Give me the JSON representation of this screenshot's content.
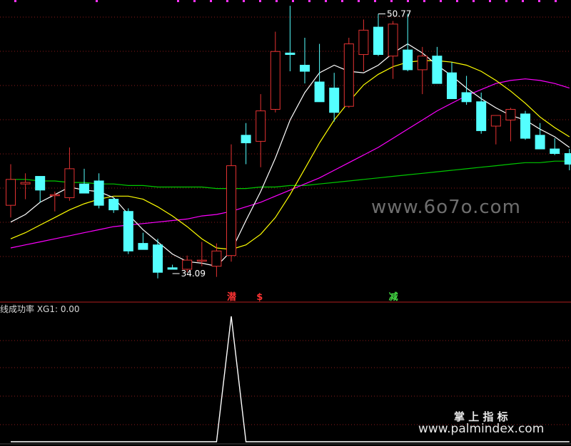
{
  "chart_data": {
    "type": "candlestick",
    "colors": {
      "up": "#e33232",
      "down": "#54ffff",
      "ma5": "#ffffff",
      "ma10": "#ffff00",
      "ma20": "#ff00ff",
      "ma60": "#00c800",
      "indicator": "#ffffff",
      "grid": "#8b1a1a",
      "mark_high": "#ffffff",
      "mark_low": "#ffffff"
    },
    "candles": [
      {
        "o": 38.2,
        "h": 40.9,
        "l": 37.4,
        "c": 39.9
      },
      {
        "o": 39.6,
        "h": 40.3,
        "l": 38.6,
        "c": 39.7
      },
      {
        "o": 40.1,
        "h": 40.1,
        "l": 38.4,
        "c": 39.2
      },
      {
        "o": 38.9,
        "h": 39.1,
        "l": 37.8,
        "c": 38.9
      },
      {
        "o": 38.7,
        "h": 42.0,
        "l": 38.5,
        "c": 40.6
      },
      {
        "o": 39.6,
        "h": 40.6,
        "l": 39.2,
        "c": 39.0
      },
      {
        "o": 39.8,
        "h": 40.3,
        "l": 38.0,
        "c": 38.2
      },
      {
        "o": 38.6,
        "h": 38.7,
        "l": 37.7,
        "c": 37.9
      },
      {
        "o": 37.8,
        "h": 38.0,
        "l": 35.0,
        "c": 35.2
      },
      {
        "o": 35.7,
        "h": 36.4,
        "l": 35.5,
        "c": 35.3
      },
      {
        "o": 35.6,
        "h": 36.0,
        "l": 33.4,
        "c": 33.8
      },
      {
        "o": 34.1,
        "h": 34.3,
        "l": 34.09,
        "c": 34.0
      },
      {
        "o": 34.0,
        "h": 34.9,
        "l": 33.8,
        "c": 34.6
      },
      {
        "o": 34.6,
        "h": 35.8,
        "l": 34.2,
        "c": 34.6
      },
      {
        "o": 34.2,
        "h": 35.7,
        "l": 33.5,
        "c": 35.2
      },
      {
        "o": 34.9,
        "h": 42.2,
        "l": 34.5,
        "c": 40.8
      },
      {
        "o": 42.8,
        "h": 43.6,
        "l": 40.9,
        "c": 42.3
      },
      {
        "o": 42.4,
        "h": 45.5,
        "l": 40.7,
        "c": 44.4
      },
      {
        "o": 44.5,
        "h": 49.6,
        "l": 44.3,
        "c": 48.3
      },
      {
        "o": 48.2,
        "h": 51.3,
        "l": 47.0,
        "c": 48.1
      },
      {
        "o": 47.4,
        "h": 49.2,
        "l": 46.2,
        "c": 47.0
      },
      {
        "o": 46.3,
        "h": 48.8,
        "l": 45.3,
        "c": 45.0
      },
      {
        "o": 45.9,
        "h": 46.9,
        "l": 43.7,
        "c": 44.3
      },
      {
        "o": 44.7,
        "h": 49.2,
        "l": 44.6,
        "c": 48.8
      },
      {
        "o": 48.1,
        "h": 50.4,
        "l": 47.0,
        "c": 49.7
      },
      {
        "o": 49.9,
        "h": 50.77,
        "l": 48.0,
        "c": 48.1
      },
      {
        "o": 48.0,
        "h": 50.3,
        "l": 46.5,
        "c": 50.1
      },
      {
        "o": 48.4,
        "h": 50.77,
        "l": 47.0,
        "c": 47.1
      },
      {
        "o": 47.1,
        "h": 48.6,
        "l": 45.5,
        "c": 48.0
      },
      {
        "o": 48.0,
        "h": 48.6,
        "l": 46.4,
        "c": 46.2
      },
      {
        "o": 46.9,
        "h": 47.6,
        "l": 45.2,
        "c": 45.2
      },
      {
        "o": 45.6,
        "h": 46.7,
        "l": 44.8,
        "c": 45.0
      },
      {
        "o": 45.0,
        "h": 45.6,
        "l": 42.9,
        "c": 43.1
      },
      {
        "o": 43.4,
        "h": 44.1,
        "l": 42.2,
        "c": 44.1
      },
      {
        "o": 43.8,
        "h": 44.6,
        "l": 42.4,
        "c": 44.5
      },
      {
        "o": 44.2,
        "h": 44.4,
        "l": 42.5,
        "c": 42.6
      },
      {
        "o": 42.8,
        "h": 43.6,
        "l": 42.0,
        "c": 41.9
      },
      {
        "o": 41.9,
        "h": 42.6,
        "l": 41.5,
        "c": 41.6
      },
      {
        "o": 41.6,
        "h": 41.9,
        "l": 40.5,
        "c": 40.9
      }
    ],
    "ma5": [
      37.1,
      37.6,
      38.4,
      38.9,
      39.4,
      39.2,
      39.1,
      38.7,
      37.6,
      36.6,
      35.8,
      35.0,
      34.5,
      34.4,
      34.2,
      35.2,
      37.2,
      39.1,
      41.3,
      43.8,
      45.6,
      46.9,
      47.4,
      47.0,
      46.9,
      47.4,
      48.2,
      48.8,
      48.2,
      47.4,
      46.7,
      45.9,
      45.2,
      44.6,
      44.1,
      43.8,
      43.2,
      42.7,
      42.0
    ],
    "ma10": [
      36.0,
      36.4,
      36.9,
      37.4,
      37.9,
      38.3,
      38.6,
      38.8,
      38.8,
      38.6,
      38.1,
      37.5,
      36.8,
      36.0,
      35.4,
      35.3,
      35.6,
      36.3,
      37.4,
      38.9,
      40.6,
      42.3,
      43.8,
      45.0,
      46.1,
      46.8,
      47.3,
      47.6,
      47.7,
      47.7,
      47.6,
      47.4,
      47.0,
      46.4,
      45.7,
      44.9,
      44.0,
      43.3,
      42.7
    ],
    "ma20": [
      35.4,
      35.6,
      35.8,
      36.0,
      36.2,
      36.4,
      36.6,
      36.8,
      36.9,
      37.0,
      37.1,
      37.2,
      37.3,
      37.5,
      37.6,
      37.8,
      38.1,
      38.4,
      38.8,
      39.2,
      39.6,
      40.0,
      40.5,
      41.0,
      41.5,
      42.0,
      42.6,
      43.2,
      43.8,
      44.4,
      44.9,
      45.4,
      45.8,
      46.2,
      46.4,
      46.5,
      46.4,
      46.2,
      45.9
    ],
    "ma60": [
      39.9,
      39.9,
      39.8,
      39.8,
      39.7,
      39.7,
      39.6,
      39.6,
      39.5,
      39.5,
      39.4,
      39.4,
      39.4,
      39.4,
      39.3,
      39.3,
      39.3,
      39.4,
      39.4,
      39.5,
      39.5,
      39.6,
      39.7,
      39.8,
      39.9,
      40.0,
      40.1,
      40.2,
      40.3,
      40.4,
      40.5,
      40.6,
      40.7,
      40.8,
      40.9,
      41.0,
      41.0,
      41.1,
      41.1
    ],
    "price_range": [
      32.5,
      51.4
    ],
    "high_mark": {
      "index": 25,
      "label": "50.77"
    },
    "low_mark": {
      "index": 11,
      "label": "34.09"
    },
    "signal_markers": [
      {
        "index": 15,
        "text": "潜",
        "color": "#ff3333"
      },
      {
        "index": 17,
        "text": "$",
        "color": "#ff3333"
      },
      {
        "index": 26,
        "text": "减",
        "color": "#44dd44"
      }
    ],
    "indicator": {
      "label": "线成功率 XG1: 0.00",
      "values": [
        0,
        0,
        0,
        0,
        0,
        0,
        0,
        0,
        0,
        0,
        0,
        0,
        0,
        0,
        0,
        1,
        0,
        0,
        0,
        0,
        0,
        0,
        0,
        0,
        0,
        0,
        0,
        0,
        0,
        0,
        0,
        0,
        0,
        0,
        0,
        0,
        0,
        0,
        0
      ],
      "range": [
        0,
        1
      ]
    }
  },
  "watermarks": {
    "center": "www.6o7o.com",
    "title": "掌 上 指 标",
    "url": "www.palmindex.com"
  }
}
